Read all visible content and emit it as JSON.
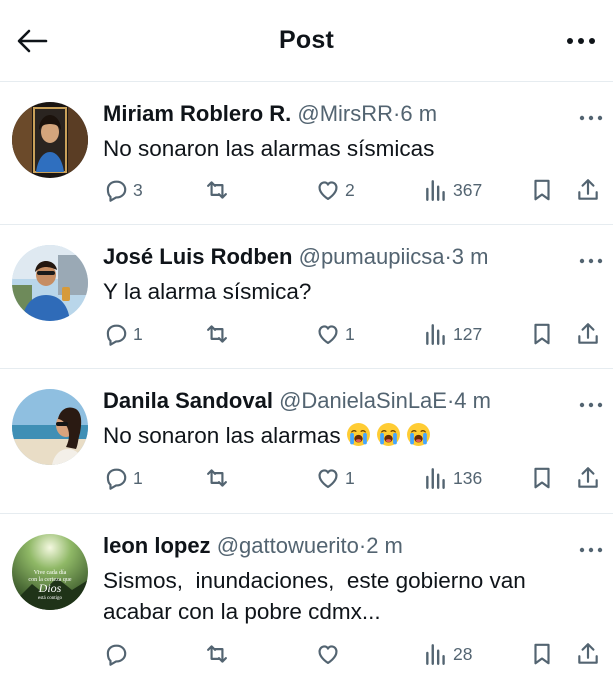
{
  "header": {
    "title": "Post",
    "back_icon": "arrow-left-icon",
    "more_icon": "more-horizontal-icon"
  },
  "colors": {
    "text": "#0f1419",
    "muted": "#536471",
    "divider": "#e6ecf0",
    "background": "#ffffff"
  },
  "tweets": [
    {
      "name": "Miriam Roblero R.",
      "handle": "@MirsRR",
      "sep": "·",
      "time": "6 m",
      "text": "No sonaron las alarmas sísmicas",
      "emoji": [],
      "replies": "3",
      "retweets": "",
      "likes": "2",
      "views": "367"
    },
    {
      "name": "José Luis Rodben",
      "handle": "@pumaupiicsa",
      "sep": "·",
      "time": "3 m",
      "text": "Y la alarma sísmica?",
      "emoji": [],
      "replies": "1",
      "retweets": "",
      "likes": "1",
      "views": "127"
    },
    {
      "name": "Danila Sandoval",
      "handle": "@DanielaSinLaE",
      "sep": "·",
      "time": "4 m",
      "text": "No sonaron las alarmas",
      "emoji": [
        "loudly-crying-face",
        "loudly-crying-face",
        "loudly-crying-face"
      ],
      "replies": "1",
      "retweets": "",
      "likes": "1",
      "views": "136"
    },
    {
      "name": "leon lopez",
      "handle": "@gattowuerito",
      "sep": "·",
      "time": "2 m",
      "text_line1": "Sismos,  inundaciones,  este gobierno van",
      "text_line2": "acabar con la pobre cdmx...",
      "emoji": [],
      "replies": "",
      "retweets": "",
      "likes": "",
      "views": "28",
      "avatar_text": {
        "line1": "Vive cada día",
        "line2": "con la certeza que",
        "line3": "Dios",
        "line4": "está contigo"
      }
    }
  ],
  "icons": [
    "reply-icon",
    "retweet-icon",
    "like-icon",
    "views-icon",
    "bookmark-icon",
    "share-icon"
  ]
}
